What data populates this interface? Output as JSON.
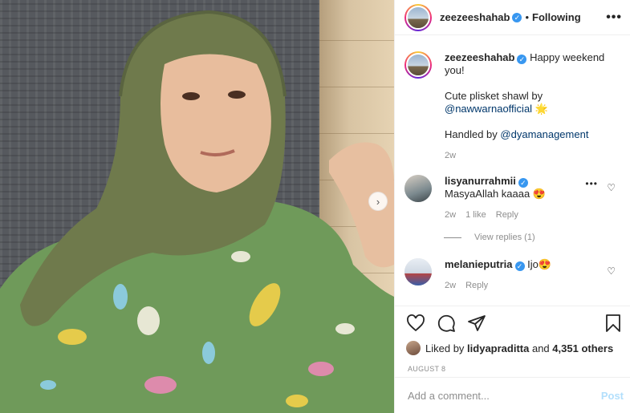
{
  "header": {
    "username": "zeezeeshahab",
    "separator": "•",
    "follow_status": "Following",
    "more_label": "•••"
  },
  "caption": {
    "username": "zeezeeshahab",
    "line1": "Happy weekend you!",
    "line2_prefix": "Cute plisket shawl by",
    "line2_mention": "@nawwarnaofficial",
    "line2_emoji": "🌟",
    "line3_prefix": "Handled by",
    "line3_mention": "@dyamanagement",
    "time": "2w"
  },
  "comments": [
    {
      "username": "lisyanurrahmii",
      "text": "MasyaAllah kaaaa 😍",
      "time": "2w",
      "likes": "1 like",
      "reply": "Reply",
      "view_replies": "View replies (1)"
    },
    {
      "username": "melanieputria",
      "text": "Ijo😍",
      "time": "2w",
      "reply": "Reply"
    }
  ],
  "likes": {
    "prefix": "Liked by",
    "user": "lidyapraditta",
    "and": "and",
    "count": "4,351 others"
  },
  "date": "AUGUST 8",
  "comment_box": {
    "placeholder": "Add a comment...",
    "post_label": "Post"
  },
  "icons": {
    "verified": "verified-badge-icon",
    "like": "heart-icon",
    "comment": "comment-icon",
    "share": "paper-plane-icon",
    "save": "bookmark-icon",
    "next": "chevron-right-icon"
  },
  "colors": {
    "mention": "#00376b",
    "verified": "#3897f0",
    "muted": "#8e8e8e",
    "post_button": "#b2dffc"
  }
}
